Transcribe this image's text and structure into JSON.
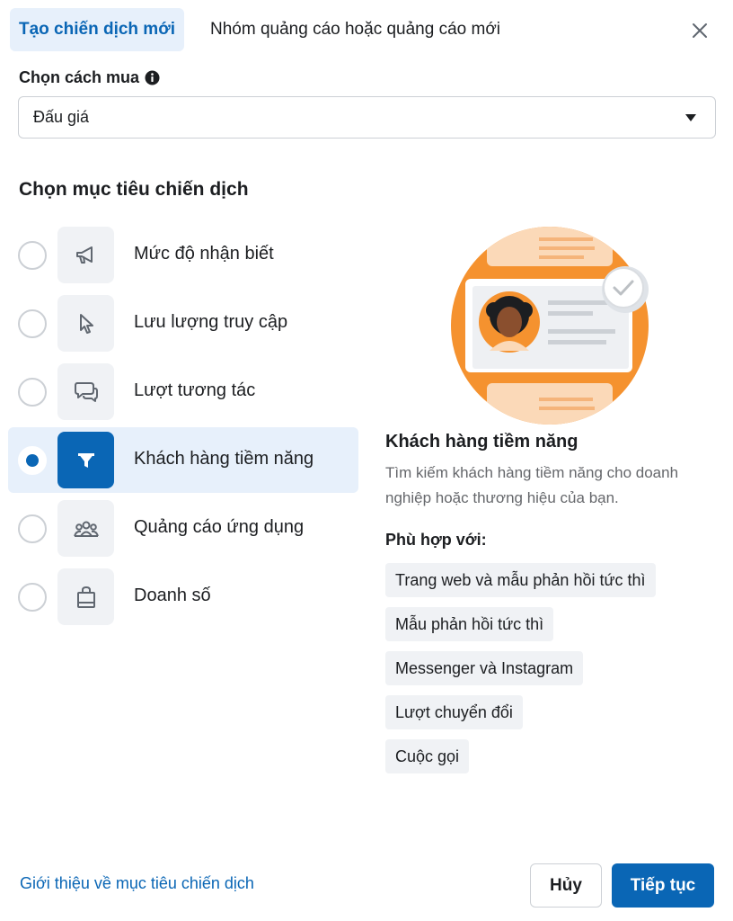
{
  "header": {
    "tabs": [
      {
        "label": "Tạo chiến dịch mới",
        "active": true
      },
      {
        "label": "Nhóm quảng cáo hoặc quảng cáo mới",
        "active": false
      }
    ],
    "close_icon": "close-icon"
  },
  "buying": {
    "label": "Chọn cách mua",
    "info_icon": "info-icon",
    "selected_value": "Đấu giá"
  },
  "objectives": {
    "title": "Chọn mục tiêu chiến dịch",
    "items": [
      {
        "label": "Mức độ nhận biết",
        "icon": "megaphone-icon",
        "selected": false
      },
      {
        "label": "Lưu lượng truy cập",
        "icon": "cursor-icon",
        "selected": false
      },
      {
        "label": "Lượt tương tác",
        "icon": "chat-bubbles-icon",
        "selected": false
      },
      {
        "label": "Khách hàng tiềm năng",
        "icon": "funnel-icon",
        "selected": true
      },
      {
        "label": "Quảng cáo ứng dụng",
        "icon": "people-group-icon",
        "selected": false
      },
      {
        "label": "Doanh số",
        "icon": "shopping-bag-icon",
        "selected": false
      }
    ]
  },
  "detail": {
    "title": "Khách hàng tiềm năng",
    "description": "Tìm kiếm khách hàng tiềm năng cho doanh nghiệp hoặc thương hiệu của bạn.",
    "fit_label": "Phù hợp với:",
    "tags": [
      "Trang web và mẫu phản hồi tức thì",
      "Mẫu phản hồi tức thì",
      "Messenger và Instagram",
      "Lượt chuyển đổi",
      "Cuộc gọi"
    ]
  },
  "footer": {
    "learn_link": "Giới thiệu về mục tiêu chiến dịch",
    "cancel_label": "Hủy",
    "continue_label": "Tiếp tục"
  },
  "colors": {
    "accent": "#0a66b5",
    "accent_light": "#e7f0fb",
    "illustration_orange": "#f5922f"
  }
}
